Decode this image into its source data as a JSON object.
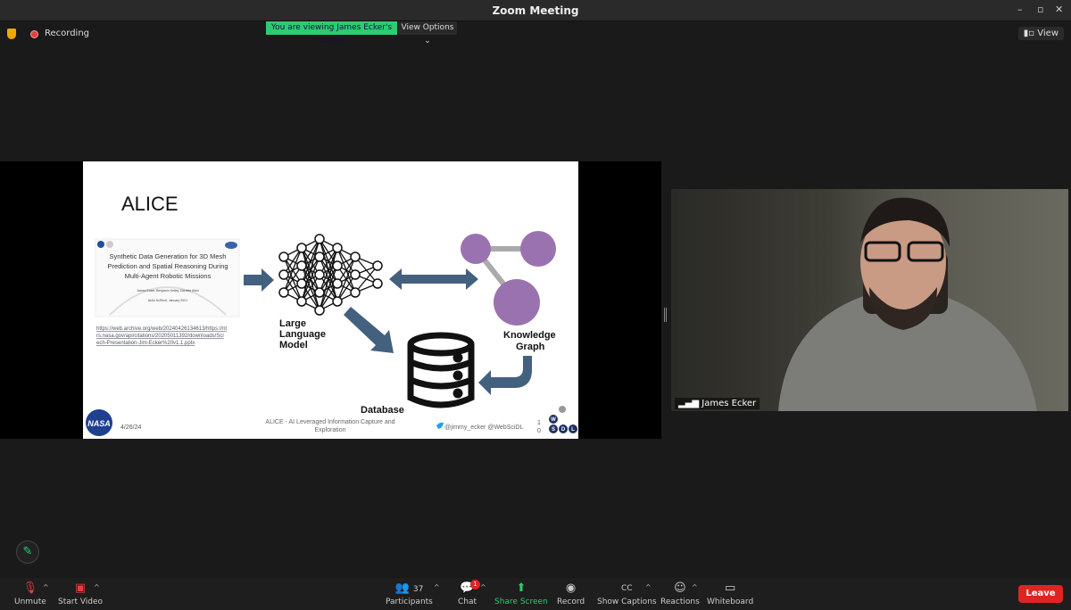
{
  "window": {
    "title": "Zoom Meeting",
    "controls": [
      "–",
      "▫",
      "✕"
    ]
  },
  "topbar": {
    "recording": "Recording",
    "viewing_banner": "You are viewing James Ecker's screen",
    "view_options": "View Options",
    "view_button": "View"
  },
  "slide": {
    "title": "ALICE",
    "paper": {
      "title_lines": [
        "Synthetic Data Generation for 3D Mesh",
        "Prediction and Spatial Reasoning During",
        "Multi-Agent Robotic Missions"
      ],
      "authors": "James Ecker, Benjamin Kelley, Danette Allen",
      "venue": "AIAA SciTech, January 2021"
    },
    "link_lines": [
      "https://web.archive.org/web/20240426134613/https://nt",
      "rs.nasa.gov/api/citations/20205011392/downloads/Sci",
      "ech-Presentation-Jim-Ecker%20v1.1.pptx"
    ],
    "llm_label": [
      "Large",
      "Language",
      "Model"
    ],
    "kg_label": [
      "Knowledge",
      "Graph"
    ],
    "db_label": "Database",
    "footer": {
      "date": "4/26/24",
      "center_lines": [
        "ALICE - AI Leveraged Information Capture and",
        "Exploration"
      ],
      "handles": "@jimmy_ecker  @WebSciDL",
      "page": [
        "1",
        "0"
      ],
      "nasa_logo": "NASA",
      "wsdl_logo": [
        "W",
        "S",
        "D",
        "L"
      ]
    },
    "colors": {
      "arrow": "#44607f",
      "node": "#9b72b0"
    }
  },
  "video": {
    "participant_name": "James Ecker"
  },
  "toolbar": {
    "unmute": "Unmute",
    "start_video": "Start Video",
    "participants": "Participants",
    "participant_count": "37",
    "chat": "Chat",
    "chat_badge": "1",
    "share_screen": "Share Screen",
    "record": "Record",
    "show_captions": "Show Captions",
    "reactions": "Reactions",
    "whiteboard": "Whiteboard",
    "leave": "Leave"
  }
}
